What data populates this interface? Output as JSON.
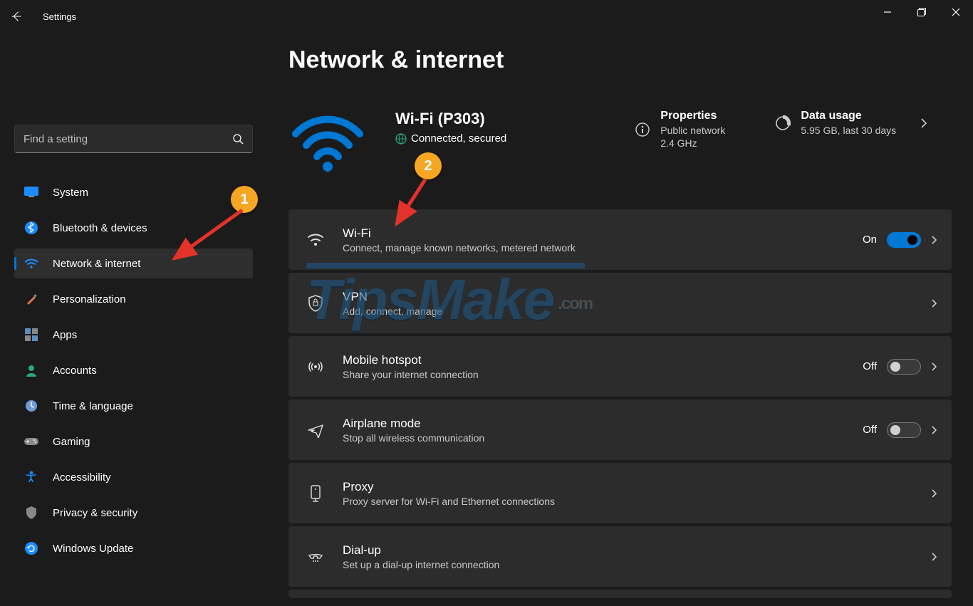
{
  "app": {
    "title": "Settings"
  },
  "search": {
    "placeholder": "Find a setting"
  },
  "sidebar": {
    "items": [
      {
        "label": "System"
      },
      {
        "label": "Bluetooth & devices"
      },
      {
        "label": "Network & internet"
      },
      {
        "label": "Personalization"
      },
      {
        "label": "Apps"
      },
      {
        "label": "Accounts"
      },
      {
        "label": "Time & language"
      },
      {
        "label": "Gaming"
      },
      {
        "label": "Accessibility"
      },
      {
        "label": "Privacy & security"
      },
      {
        "label": "Windows Update"
      }
    ],
    "active_index": 2
  },
  "page": {
    "title": "Network & internet",
    "network": {
      "name": "Wi-Fi (P303)",
      "status": "Connected, secured"
    },
    "properties": {
      "title": "Properties",
      "line1": "Public network",
      "line2": "2.4 GHz"
    },
    "data_usage": {
      "title": "Data usage",
      "line1": "5.95 GB, last 30 days"
    },
    "cards": [
      {
        "title": "Wi-Fi",
        "sub": "Connect, manage known networks, metered network",
        "control": "toggle",
        "state_label": "On",
        "state": "on"
      },
      {
        "title": "VPN",
        "sub": "Add, connect, manage",
        "control": "none"
      },
      {
        "title": "Mobile hotspot",
        "sub": "Share your internet connection",
        "control": "toggle",
        "state_label": "Off",
        "state": "off"
      },
      {
        "title": "Airplane mode",
        "sub": "Stop all wireless communication",
        "control": "toggle",
        "state_label": "Off",
        "state": "off"
      },
      {
        "title": "Proxy",
        "sub": "Proxy server for Wi-Fi and Ethernet connections",
        "control": "none"
      },
      {
        "title": "Dial-up",
        "sub": "Set up a dial-up internet connection",
        "control": "none"
      }
    ]
  },
  "annotations": {
    "badge1": "1",
    "badge2": "2"
  },
  "watermark": {
    "text": "TipsMake",
    "suffix": ".com"
  }
}
